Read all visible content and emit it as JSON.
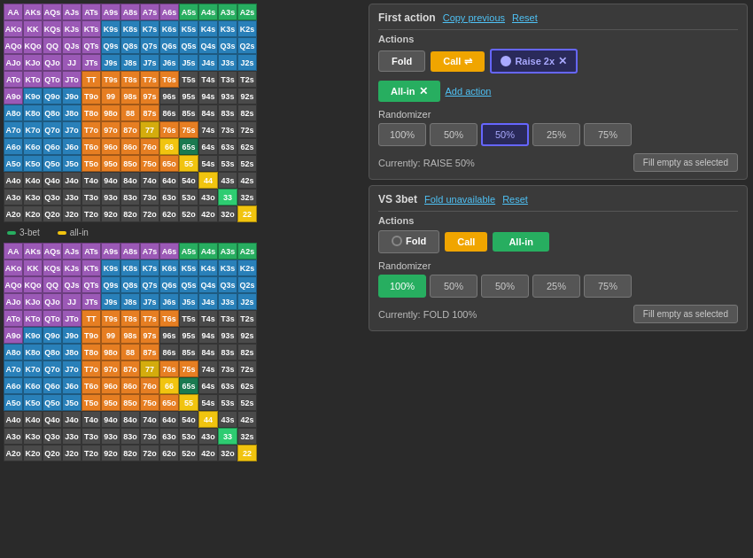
{
  "header1": {
    "label": "First action",
    "copy_previous": "Copy previous",
    "reset": "Reset"
  },
  "header2": {
    "label": "VS 3bet",
    "fold_unavailable": "Fold unavailable",
    "reset": "Reset"
  },
  "panel1": {
    "actions_label": "Actions",
    "fold_label": "Fold",
    "call_label": "Call",
    "raise_label": "Raise 2x",
    "allin_label": "All-in",
    "add_action_label": "Add action",
    "randomizer_label": "Randomizer",
    "rand_values": [
      "100%",
      "50%",
      "50%",
      "25%",
      "75%"
    ],
    "currently_text": "Currently: RAISE 50%",
    "fill_label": "Fill empty as selected"
  },
  "panel2": {
    "actions_label": "Actions",
    "fold_label": "Fold",
    "call_label": "Call",
    "allin_label": "All-in",
    "randomizer_label": "Randomizer",
    "rand_values": [
      "100%",
      "50%",
      "50%",
      "25%",
      "75%"
    ],
    "currently_text": "Currently: FOLD 100%",
    "fill_label": "Fill empty as selected"
  },
  "legend": {
    "item1": "3-bet",
    "item2": "all-in"
  },
  "grid_rows_top": [
    [
      "AA",
      "AKs",
      "AQs",
      "AJs",
      "ATs",
      "A9s",
      "A8s",
      "A7s",
      "A6s",
      "A5s",
      "A4s",
      "A3s",
      "A2s"
    ],
    [
      "AKo",
      "KK",
      "KQs",
      "KJs",
      "KTs",
      "K9s",
      "K8s",
      "K7s",
      "K6s",
      "K5s",
      "K4s",
      "K3s",
      "K2s"
    ],
    [
      "AQo",
      "KQo",
      "QQ",
      "QJs",
      "QTs",
      "Q9s",
      "Q8s",
      "Q7s",
      "Q6s",
      "Q5s",
      "Q4s",
      "Q3s",
      "Q2s"
    ],
    [
      "AJo",
      "KJo",
      "QJo",
      "JJ",
      "JTs",
      "J9s",
      "J8s",
      "J7s",
      "J6s",
      "J5s",
      "J4s",
      "J3s",
      "J2s"
    ],
    [
      "ATo",
      "KTo",
      "QTo",
      "JTo",
      "TT",
      "T9s",
      "T8s",
      "T7s",
      "T6s",
      "T5s",
      "T4s",
      "T3s",
      "T2s"
    ],
    [
      "A9o",
      "K9o",
      "Q9o",
      "J9o",
      "T9o",
      "99",
      "98s",
      "97s",
      "96s",
      "95s",
      "94s",
      "93s",
      "92s"
    ],
    [
      "A8o",
      "K8o",
      "Q8o",
      "J8o",
      "T8o",
      "98o",
      "88",
      "87s",
      "86s",
      "85s",
      "84s",
      "83s",
      "82s"
    ],
    [
      "A7o",
      "K7o",
      "Q7o",
      "J7o",
      "T7o",
      "97o",
      "87o",
      "77",
      "76s",
      "75s",
      "74s",
      "73s",
      "72s"
    ],
    [
      "A6o",
      "K6o",
      "Q6o",
      "J6o",
      "T6o",
      "96o",
      "86o",
      "76o",
      "66",
      "65s",
      "64s",
      "63s",
      "62s"
    ],
    [
      "A5o",
      "K5o",
      "Q5o",
      "J5o",
      "T5o",
      "95o",
      "85o",
      "75o",
      "65o",
      "55",
      "54s",
      "53s",
      "52s"
    ],
    [
      "A4o",
      "K4o",
      "Q4o",
      "J4o",
      "T4o",
      "94o",
      "84o",
      "74o",
      "64o",
      "54o",
      "44",
      "43s",
      "42s"
    ],
    [
      "A3o",
      "K3o",
      "Q3o",
      "J3o",
      "T3o",
      "93o",
      "83o",
      "73o",
      "63o",
      "53o",
      "43o",
      "33",
      "32s"
    ],
    [
      "A2o",
      "K2o",
      "Q2o",
      "J2o",
      "T2o",
      "92o",
      "82o",
      "72o",
      "62o",
      "52o",
      "42o",
      "32o",
      "22"
    ]
  ],
  "grid_colors_top": [
    [
      "purple",
      "purple",
      "purple",
      "purple",
      "purple",
      "purple",
      "purple",
      "purple",
      "purple",
      "green",
      "green",
      "green",
      "green"
    ],
    [
      "purple",
      "purple",
      "purple",
      "purple",
      "purple",
      "blue",
      "blue",
      "blue",
      "blue",
      "blue",
      "blue",
      "blue",
      "blue"
    ],
    [
      "purple",
      "purple",
      "purple",
      "purple",
      "purple",
      "blue",
      "blue",
      "blue",
      "blue",
      "blue",
      "blue",
      "blue",
      "blue"
    ],
    [
      "purple",
      "purple",
      "purple",
      "purple",
      "purple",
      "blue",
      "blue",
      "blue",
      "blue",
      "blue",
      "blue",
      "blue",
      "blue"
    ],
    [
      "purple",
      "purple",
      "purple",
      "purple",
      "orange",
      "orange",
      "orange",
      "orange",
      "orange",
      "dark",
      "dark",
      "dark",
      "dark"
    ],
    [
      "purple",
      "blue",
      "blue",
      "blue",
      "orange",
      "orange",
      "orange",
      "orange",
      "dark",
      "dark",
      "dark",
      "dark",
      "dark"
    ],
    [
      "blue",
      "blue",
      "blue",
      "blue",
      "orange",
      "orange",
      "orange",
      "orange",
      "dark",
      "dark",
      "dark",
      "dark",
      "dark"
    ],
    [
      "blue",
      "blue",
      "blue",
      "blue",
      "orange",
      "orange",
      "orange",
      "yellow",
      "orange",
      "orange",
      "dark",
      "dark",
      "dark"
    ],
    [
      "blue",
      "blue",
      "blue",
      "blue",
      "orange",
      "orange",
      "orange",
      "orange",
      "yellow",
      "teal-mixed",
      "dark",
      "dark",
      "dark"
    ],
    [
      "blue",
      "blue",
      "blue",
      "blue",
      "orange",
      "orange",
      "orange",
      "orange",
      "orange",
      "yellow",
      "dark",
      "dark",
      "dark"
    ],
    [
      "dark",
      "dark",
      "dark",
      "dark",
      "dark",
      "dark",
      "dark",
      "dark",
      "dark",
      "dark",
      "yellow",
      "dark",
      "dark"
    ],
    [
      "dark",
      "dark",
      "dark",
      "dark",
      "dark",
      "dark",
      "dark",
      "dark",
      "dark",
      "dark",
      "dark",
      "green2",
      "dark"
    ],
    [
      "dark",
      "dark",
      "dark",
      "dark",
      "dark",
      "dark",
      "dark",
      "dark",
      "dark",
      "dark",
      "dark",
      "dark",
      "yellow2"
    ]
  ]
}
